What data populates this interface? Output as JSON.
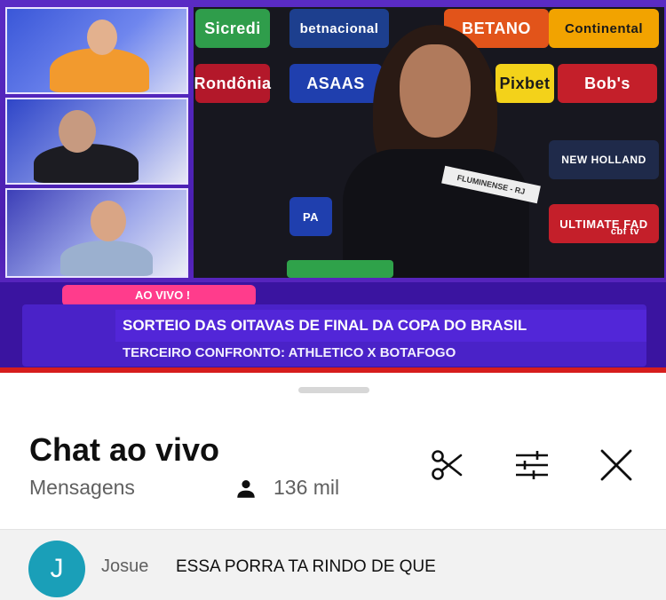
{
  "broadcast": {
    "sponsors": [
      "Sicredi",
      "betnacional",
      "BETANO",
      "Continental",
      "Rondônia",
      "ASAAS",
      "Pixbet",
      "Bob's",
      "NEW HOLLAND",
      "PA",
      "ULTIMATE FAD",
      "cbf tv"
    ],
    "slip_text": "FLUMINENSE - RJ",
    "live_badge": "AO VIVO !",
    "ticker_headline": "SORTEIO DAS OITAVAS DE FINAL DA COPA DO BRASIL",
    "ticker_subline": "TERCEIRO CONFRONTO: ATHLETICO X BOTAFOGO"
  },
  "chat": {
    "title": "Chat ao vivo",
    "subtitle": "Mensagens",
    "viewers": "136 mil",
    "icons": {
      "clip": "scissors-icon",
      "filter": "sliders-icon",
      "close": "close-icon",
      "viewers": "person-icon"
    },
    "messages": [
      {
        "avatar_letter": "J",
        "author": "Josue",
        "text": "ESSA PORRA TA RINDO DE QUE",
        "avatar_color": "#1a9fb8"
      }
    ]
  },
  "colors": {
    "brand_purple": "#4a22c8",
    "live_pink": "#ff3c8c",
    "progress_red": "#d61d1d"
  }
}
